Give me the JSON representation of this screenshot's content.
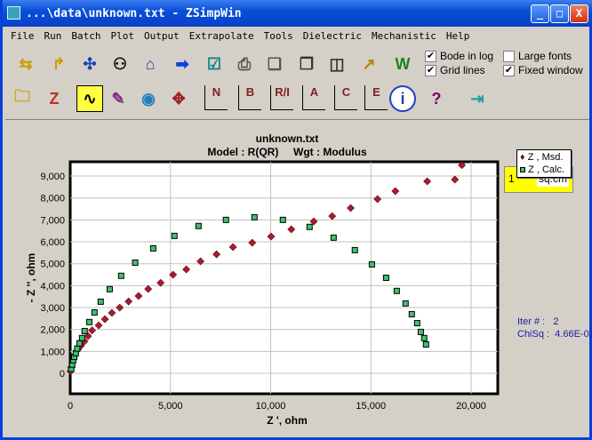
{
  "window": {
    "title": "...\\data\\unknown.txt - ZSimpWin",
    "controls": {
      "minimize": "_",
      "maximize": "□",
      "close": "X"
    }
  },
  "menu": [
    "File",
    "Run",
    "Batch",
    "Plot",
    "Output",
    "Extrapolate",
    "Tools",
    "Dielectric",
    "Mechanistic",
    "Help"
  ],
  "toolbar1": {
    "icons": [
      "import-icon",
      "export-icon",
      "model-icon",
      "search-binoculars-icon",
      "home-icon",
      "run-arrow-icon",
      "checkmark-icon",
      "print-icon",
      "pages-icon",
      "copy-icon",
      "graph-copy-icon",
      "graph-export-icon",
      "word-icon"
    ],
    "checkboxes": [
      {
        "label": "Bode in log",
        "checked": true
      },
      {
        "label": "Grid lines",
        "checked": true
      },
      {
        "label": "Large fonts",
        "checked": false
      },
      {
        "label": "Fixed window",
        "checked": true
      }
    ]
  },
  "toolbar2": {
    "icons": [
      "open-folder-icon",
      "zip-icon",
      "waveform-icon",
      "edit-notepad-icon",
      "eye-icon",
      "move-arrows-icon",
      "nyquist-plot-icon",
      "bode-plot-icon",
      "real-imag-plot-icon",
      "admittance-plot-icon",
      "capacitance-plot-icon",
      "modulus-plot-icon",
      "info-icon",
      "help-book-icon",
      "exit-door-icon"
    ],
    "plot_letters": [
      "N",
      "B",
      "R/I",
      "A",
      "C",
      "E"
    ],
    "area": {
      "value": "1",
      "unit": "sq.cm"
    }
  },
  "status": {
    "iter": "Iter # :   2",
    "chisq": "ChiSq :  4.66E-02"
  },
  "chart_data": {
    "type": "scatter",
    "title": "unknown.txt",
    "subtitle": "Model : R(QR)     Wgt : Modulus",
    "xlabel": "Z ', ohm",
    "ylabel": "- Z '', ohm",
    "xlim": [
      0,
      21330
    ],
    "ylim": [
      -930,
      9650
    ],
    "xticks": [
      0,
      5000,
      10000,
      15000,
      20000
    ],
    "xtick_labels": [
      "0",
      "5,000",
      "10,000",
      "15,000",
      "20,000"
    ],
    "yticks": [
      0,
      1000,
      2000,
      3000,
      4000,
      5000,
      6000,
      7000,
      8000,
      9000
    ],
    "ytick_labels": [
      "0",
      "1,000",
      "2,000",
      "3,000",
      "4,000",
      "5,000",
      "6,000",
      "7,000",
      "8,000",
      "9,000"
    ],
    "grid": true,
    "legend": "top-right",
    "series": [
      {
        "name": "Z , Msd.",
        "color": "#b01830",
        "marker": "diamond",
        "points": [
          [
            20,
            100
          ],
          [
            50,
            250
          ],
          [
            100,
            500
          ],
          [
            200,
            800
          ],
          [
            380,
            1090
          ],
          [
            530,
            1260
          ],
          [
            710,
            1460
          ],
          [
            890,
            1700
          ],
          [
            1090,
            1960
          ],
          [
            1420,
            2190
          ],
          [
            1730,
            2470
          ],
          [
            2080,
            2760
          ],
          [
            2470,
            3000
          ],
          [
            2910,
            3280
          ],
          [
            3410,
            3530
          ],
          [
            3890,
            3850
          ],
          [
            4510,
            4130
          ],
          [
            5130,
            4500
          ],
          [
            5790,
            4740
          ],
          [
            6500,
            5110
          ],
          [
            7300,
            5430
          ],
          [
            8120,
            5760
          ],
          [
            9080,
            5960
          ],
          [
            10020,
            6240
          ],
          [
            11030,
            6570
          ],
          [
            12150,
            6930
          ],
          [
            13070,
            7170
          ],
          [
            13990,
            7540
          ],
          [
            15330,
            7950
          ],
          [
            16220,
            8310
          ],
          [
            17810,
            8760
          ],
          [
            19190,
            8840
          ],
          [
            19540,
            9500
          ]
        ]
      },
      {
        "name": "Z , Calc.",
        "color": "#40c070",
        "marker": "square",
        "points": [
          [
            50,
            200
          ],
          [
            100,
            400
          ],
          [
            150,
            600
          ],
          [
            200,
            750
          ],
          [
            280,
            920
          ],
          [
            350,
            1130
          ],
          [
            460,
            1370
          ],
          [
            590,
            1610
          ],
          [
            720,
            1930
          ],
          [
            950,
            2340
          ],
          [
            1210,
            2780
          ],
          [
            1520,
            3270
          ],
          [
            1970,
            3840
          ],
          [
            2540,
            4450
          ],
          [
            3240,
            5050
          ],
          [
            4140,
            5700
          ],
          [
            5200,
            6270
          ],
          [
            6400,
            6720
          ],
          [
            7770,
            7000
          ],
          [
            9190,
            7120
          ],
          [
            10610,
            7000
          ],
          [
            11940,
            6680
          ],
          [
            13140,
            6190
          ],
          [
            14200,
            5620
          ],
          [
            15050,
            4970
          ],
          [
            15760,
            4360
          ],
          [
            16290,
            3760
          ],
          [
            16730,
            3190
          ],
          [
            17040,
            2700
          ],
          [
            17310,
            2290
          ],
          [
            17490,
            1890
          ],
          [
            17660,
            1610
          ],
          [
            17750,
            1320
          ]
        ]
      }
    ]
  }
}
